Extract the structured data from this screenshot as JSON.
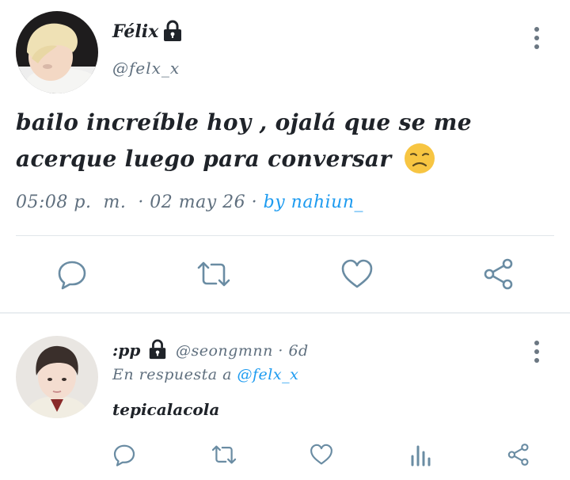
{
  "main_tweet": {
    "display_name": "Félix",
    "handle": "@felx_x",
    "text": "bailo increíble hoy ,  ojalá que se me acerque luego para conversar",
    "emoji": "disappointed-face",
    "time": "05:08 p.  m.",
    "date": "· 02 may 26 ·",
    "by": "by nahiun_",
    "actions": [
      "reply-icon",
      "retweet-icon",
      "like-icon",
      "share-icon"
    ]
  },
  "reply_tweet": {
    "display_name": ":pp",
    "handle_and_age": "@seongmnn · 6d",
    "replying_prefix": "En respuesta a",
    "replying_to": "@felx_x",
    "text": "tepicalacola",
    "actions": [
      "reply-icon",
      "retweet-icon",
      "like-icon",
      "analytics-icon",
      "share-icon"
    ]
  },
  "colors": {
    "text": "#1f2329",
    "secondary": "#5f6f7e",
    "link": "#1d9bf0",
    "icon": "#6a8ca3",
    "divider": "#e1e6ea"
  }
}
